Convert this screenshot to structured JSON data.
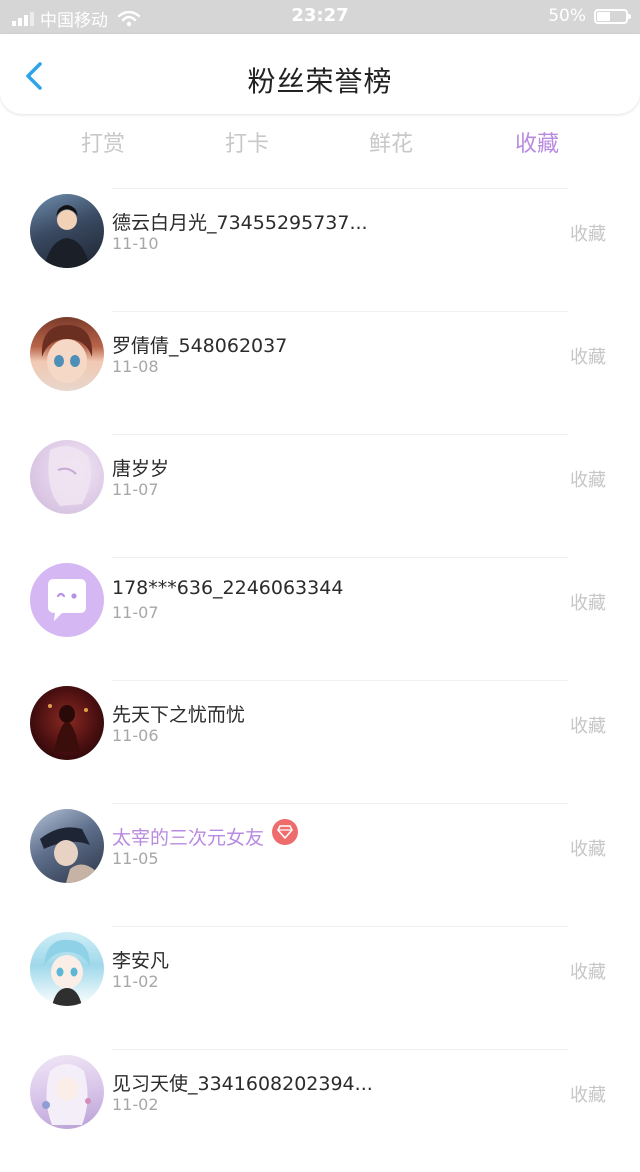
{
  "status_bar": {
    "carrier": "中国移动",
    "time": "23:27",
    "battery": "50%"
  },
  "header": {
    "title": "粉丝荣誉榜"
  },
  "tabs": [
    {
      "label": "打赏",
      "active": false
    },
    {
      "label": "打卡",
      "active": false
    },
    {
      "label": "鲜花",
      "active": false
    },
    {
      "label": "收藏",
      "active": true
    }
  ],
  "colors": {
    "accent": "#b98be0",
    "badge": "#ef6c6c"
  },
  "list": [
    {
      "name": "德云白月光_73455295737...",
      "date": "11-10",
      "action": "收藏"
    },
    {
      "name": "罗倩倩_548062037",
      "date": "11-08",
      "action": "收藏"
    },
    {
      "name": "唐岁岁",
      "date": "11-07",
      "action": "收藏"
    },
    {
      "name": "178***636_2246063344",
      "date": "11-07",
      "action": "收藏"
    },
    {
      "name": "先天下之忧而忧",
      "date": "11-06",
      "action": "收藏"
    },
    {
      "name": "太宰的三次元女友",
      "date": "11-05",
      "action": "收藏",
      "badge_icon": "diamond-icon"
    },
    {
      "name": "李安凡",
      "date": "11-02",
      "action": "收藏"
    },
    {
      "name": "见习天使_3341608202394...",
      "date": "11-02",
      "action": "收藏"
    }
  ]
}
